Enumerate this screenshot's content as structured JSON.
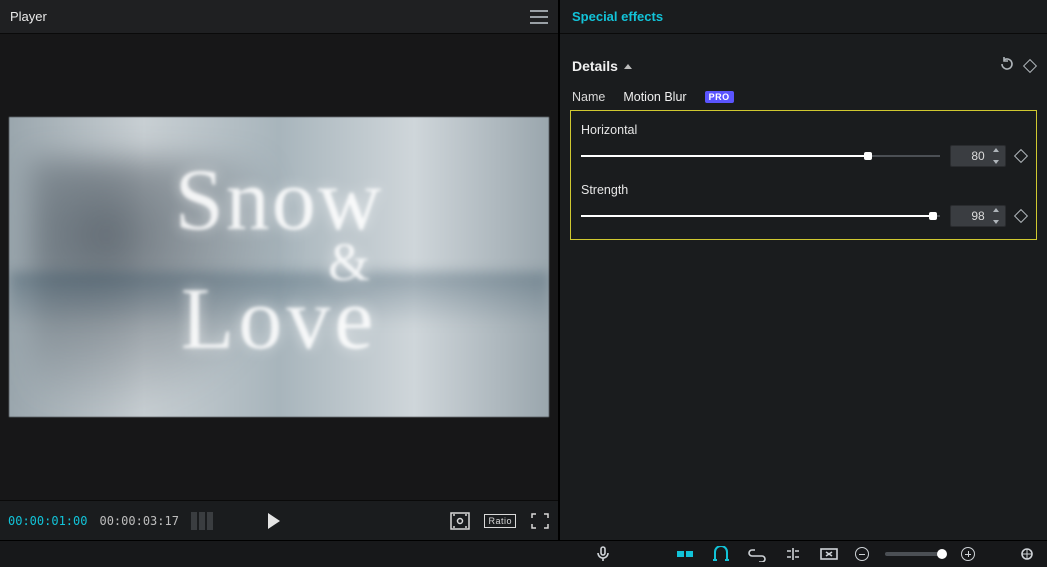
{
  "left": {
    "title": "Player",
    "videoOverlay": {
      "line1": "Snow",
      "amp": "&",
      "line2": "Love"
    },
    "transport": {
      "current": "00:00:01:00",
      "duration": "00:00:03:17",
      "ratio_label": "Ratio"
    }
  },
  "right": {
    "title": "Special effects",
    "details_label": "Details",
    "name_label": "Name",
    "effect_name": "Motion Blur",
    "pro_label": "PRO",
    "sliders": [
      {
        "label": "Horizontal",
        "value": 80,
        "max": 100
      },
      {
        "label": "Strength",
        "value": 98,
        "max": 100
      }
    ]
  }
}
